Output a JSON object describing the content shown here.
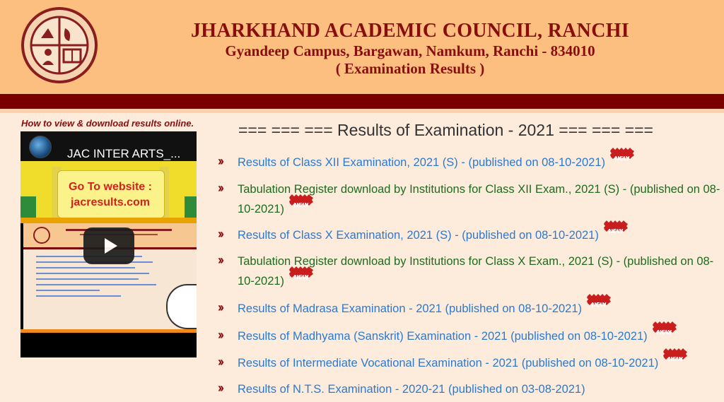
{
  "header": {
    "title": "JHARKHAND ACADEMIC COUNCIL, RANCHI",
    "address": "Gyandeep Campus, Bargawan, Namkum, Ranchi - 834010",
    "subtitle": "( Examination Results )",
    "colors": {
      "header_bg": "#fdbf80",
      "band": "#7a0000",
      "title": "#8a0d0d"
    }
  },
  "sidebar": {
    "howto_label": "How to view & download results online.",
    "video": {
      "title": "JAC INTER ARTS_...",
      "go_line1": "Go To website :",
      "go_line2": "jacresults.com"
    }
  },
  "main": {
    "heading": "=== === === Results of Examination - 2021 === === ===",
    "new_label": "NEW",
    "items": [
      {
        "text": "Results of Class XII Examination, 2021 (S) - (published on 08-10-2021)",
        "color": "#2a7ad2",
        "new": true
      },
      {
        "text": "Tabulation Register download by Institutions for Class XII Exam., 2021 (S) - (published on 08-10-2021)",
        "color": "#1f6b1f",
        "new": true
      },
      {
        "text": "Results of Class X Examination, 2021 (S) - (published on 08-10-2021)",
        "color": "#2a7ad2",
        "new": true
      },
      {
        "text": "Tabulation Register download by Institutions for Class X Exam., 2021 (S) - (published on 08-10-2021)",
        "color": "#1f6b1f",
        "new": true
      },
      {
        "text": "Results of Madrasa Examination - 2021 (published on 08-10-2021)",
        "color": "#2a7ad2",
        "new": true
      },
      {
        "text": "Results of Madhyama (Sanskrit) Examination - 2021 (published on 08-10-2021)",
        "color": "#2a7ad2",
        "new": true
      },
      {
        "text": "Results of Intermediate Vocational Examination - 2021 (published on 08-10-2021)",
        "color": "#2a7ad2",
        "new": true
      },
      {
        "text": "Results of N.T.S. Examination - 2020-21 (published on 03-08-2021)",
        "color": "#2a7ad2",
        "new": false
      }
    ]
  }
}
